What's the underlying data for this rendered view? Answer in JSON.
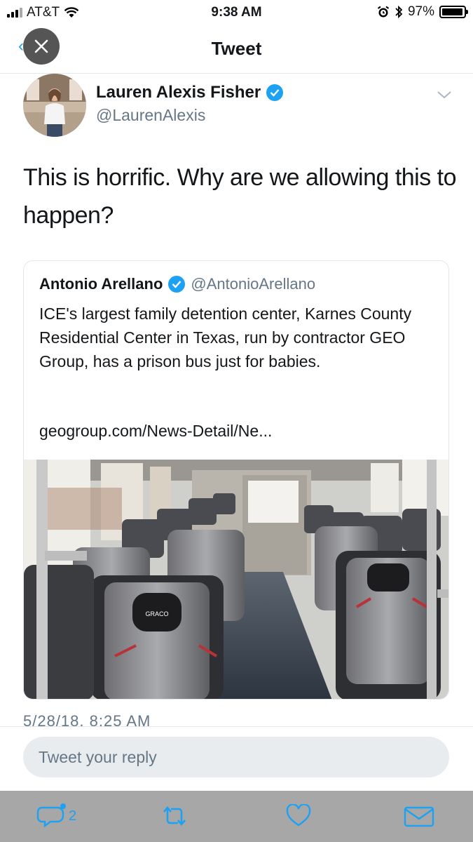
{
  "status_bar": {
    "carrier": "AT&T",
    "time": "9:38 AM",
    "battery": "97%",
    "battery_level": 0.97
  },
  "nav": {
    "title": "Tweet"
  },
  "tweet": {
    "author_name": "Lauren Alexis Fisher",
    "author_handle": "@LaurenAlexis",
    "text": "This is horrific. Why are we allowing this to happen?",
    "timestamp": "5/28/18, 8:25 AM"
  },
  "quoted_tweet": {
    "author_name": "Antonio Arellano",
    "author_handle": "@AntonioArellano",
    "text": "ICE's largest family detention center, Karnes County Residential Center in Texas, run by contractor GEO Group, has a prison bus just for babies.",
    "link": "geogroup.com/News-Detail/Ne...",
    "seat_brand": "GRACO"
  },
  "reply": {
    "placeholder": "Tweet your reply"
  },
  "actions": {
    "reply_count": "2"
  },
  "colors": {
    "accent": "#1da1f2",
    "secondary_text": "#657786",
    "action_bar_bg": "#a7a7a7"
  }
}
